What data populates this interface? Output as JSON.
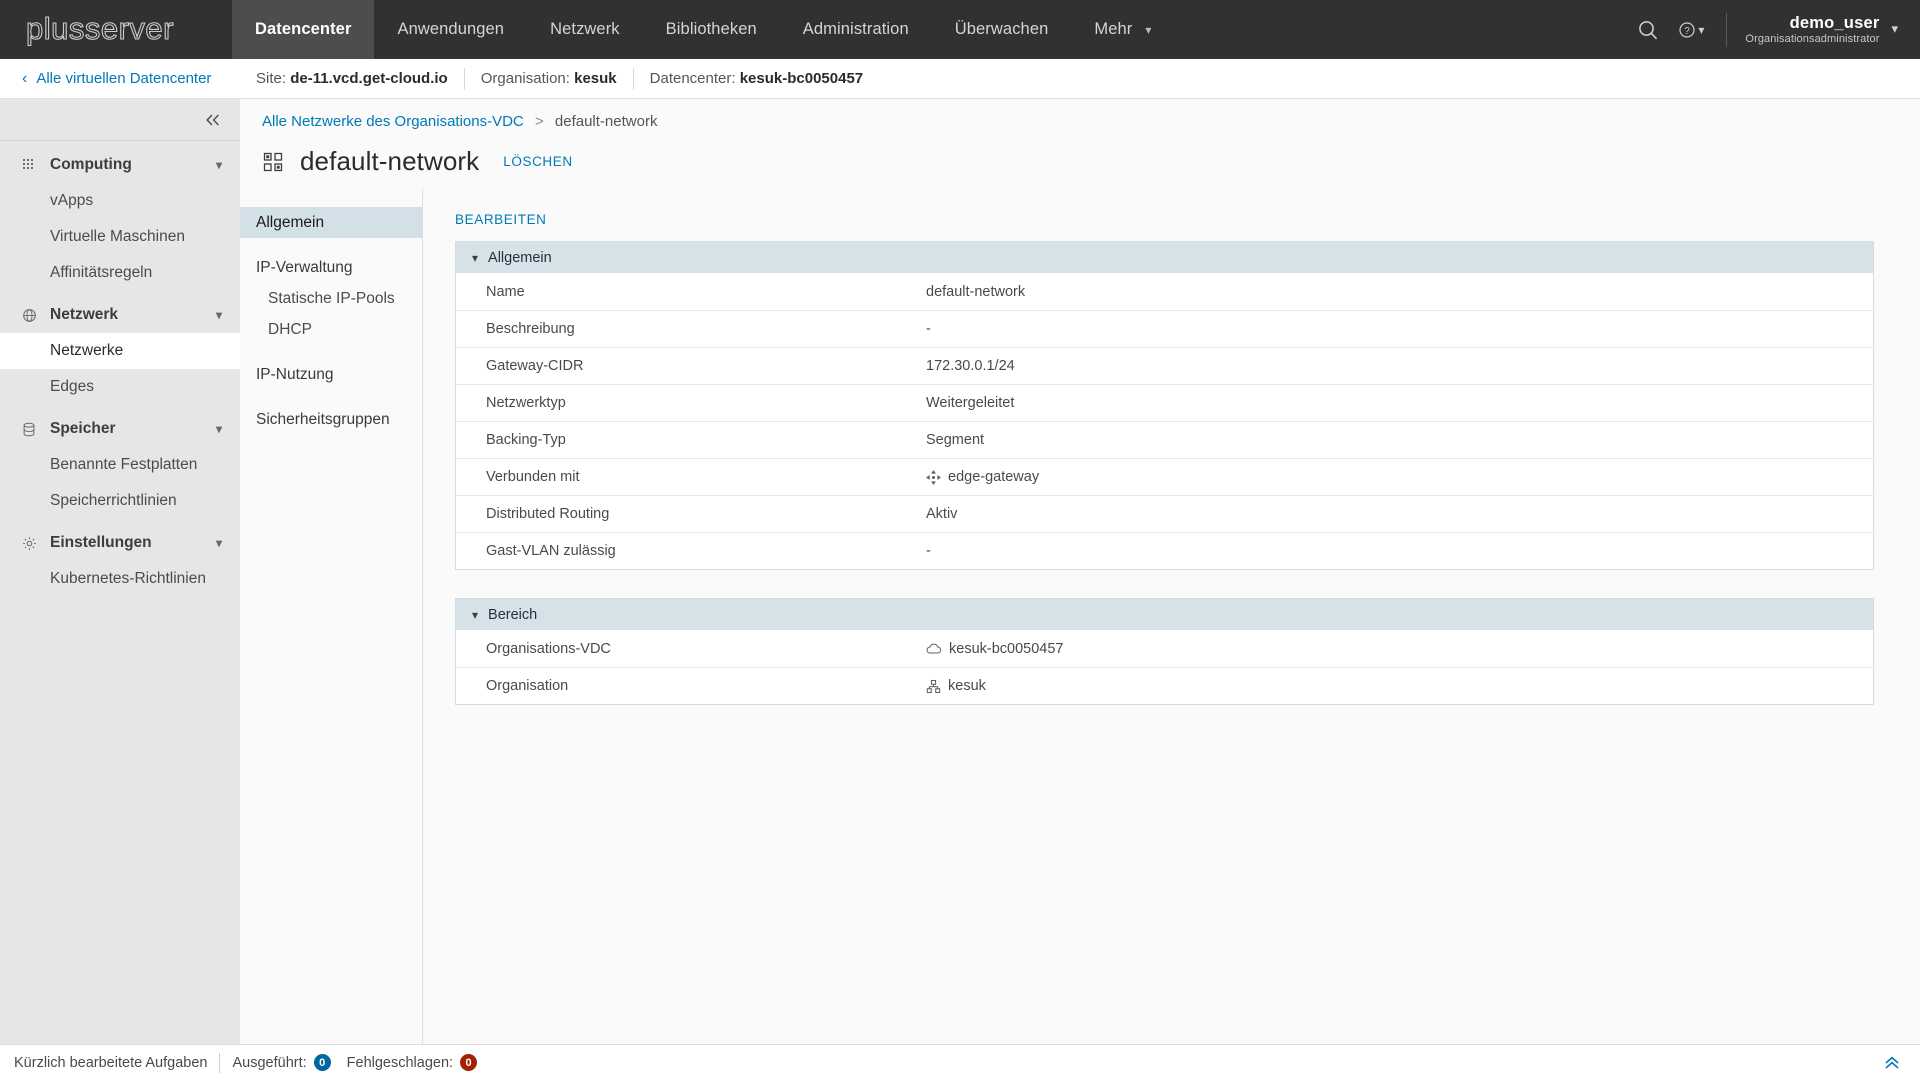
{
  "topnav": {
    "brand": "plusserver",
    "items": [
      {
        "label": "Datencenter",
        "active": true,
        "caret": false
      },
      {
        "label": "Anwendungen",
        "active": false,
        "caret": false
      },
      {
        "label": "Netzwerk",
        "active": false,
        "caret": false
      },
      {
        "label": "Bibliotheken",
        "active": false,
        "caret": false
      },
      {
        "label": "Administration",
        "active": false,
        "caret": false
      },
      {
        "label": "Überwachen",
        "active": false,
        "caret": false
      },
      {
        "label": "Mehr",
        "active": false,
        "caret": true
      }
    ],
    "search_icon": "search-icon",
    "help_icon": "help-icon",
    "user_name": "demo_user",
    "user_role": "Organisationsadministrator"
  },
  "context_bar": {
    "back_label": "Alle virtuellen Datencenter",
    "site_label": "Site:",
    "site_value": "de-11.vcd.get-cloud.io",
    "org_label": "Organisation:",
    "org_value": "kesuk",
    "dc_label": "Datencenter:",
    "dc_value": "kesuk-bc0050457"
  },
  "sidebar": {
    "collapse_label": "«",
    "groups": [
      {
        "label": "Computing",
        "icon": "grid-dots-icon",
        "items": [
          {
            "label": "vApps",
            "selected": false
          },
          {
            "label": "Virtuelle Maschinen",
            "selected": false
          },
          {
            "label": "Affinitätsregeln",
            "selected": false
          }
        ]
      },
      {
        "label": "Netzwerk",
        "icon": "globe-icon",
        "items": [
          {
            "label": "Netzwerke",
            "selected": true
          },
          {
            "label": "Edges",
            "selected": false
          }
        ]
      },
      {
        "label": "Speicher",
        "icon": "database-icon",
        "items": [
          {
            "label": "Benannte Festplatten",
            "selected": false
          },
          {
            "label": "Speicherrichtlinien",
            "selected": false
          }
        ]
      },
      {
        "label": "Einstellungen",
        "icon": "gear-icon",
        "items": [
          {
            "label": "Kubernetes-Richtlinien",
            "selected": false
          }
        ]
      }
    ]
  },
  "page": {
    "breadcrumb_link": "Alle Netzwerke des Organisations-VDC",
    "breadcrumb_sep": ">",
    "breadcrumb_current": "default-network",
    "title": "default-network",
    "title_icon": "network-icon",
    "delete_label": "LÖSCHEN"
  },
  "subnav": [
    {
      "label": "Allgemein",
      "active": true,
      "sub": false
    },
    {
      "label": "IP-Verwaltung",
      "active": false,
      "sub": false
    },
    {
      "label": "Statische IP-Pools",
      "active": false,
      "sub": true
    },
    {
      "label": "DHCP",
      "active": false,
      "sub": true
    },
    {
      "label": "IP-Nutzung",
      "active": false,
      "sub": false
    },
    {
      "label": "Sicherheitsgruppen",
      "active": false,
      "sub": false
    }
  ],
  "detail": {
    "edit_label": "BEARBEITEN",
    "sections": [
      {
        "title": "Allgemein",
        "rows": [
          {
            "key": "Name",
            "value": "default-network",
            "icon": null
          },
          {
            "key": "Beschreibung",
            "value": "-",
            "icon": null
          },
          {
            "key": "Gateway-CIDR",
            "value": "172.30.0.1/24",
            "icon": null
          },
          {
            "key": "Netzwerktyp",
            "value": "Weitergeleitet",
            "icon": null
          },
          {
            "key": "Backing-Typ",
            "value": "Segment",
            "icon": null
          },
          {
            "key": "Verbunden mit",
            "value": "edge-gateway",
            "icon": "edge-gateway-icon"
          },
          {
            "key": "Distributed Routing",
            "value": "Aktiv",
            "icon": null
          },
          {
            "key": "Gast-VLAN zulässig",
            "value": "-",
            "icon": null
          }
        ]
      },
      {
        "title": "Bereich",
        "rows": [
          {
            "key": "Organisations-VDC",
            "value": "kesuk-bc0050457",
            "icon": "cloud-icon"
          },
          {
            "key": "Organisation",
            "value": "kesuk",
            "icon": "org-icon"
          }
        ]
      }
    ]
  },
  "footer": {
    "tasks_label": "Kürzlich bearbeitete Aufgaben",
    "executed_label": "Ausgeführt:",
    "executed_count": "0",
    "failed_label": "Fehlgeschlagen:",
    "failed_count": "0",
    "expand_icon": "chevron-double-up-icon"
  },
  "colors": {
    "topnav_bg": "#313131",
    "topnav_active": "#4d4d4d",
    "link": "#0079b8",
    "card_header": "#d6e1e8",
    "subnav_active": "#d3e0e8",
    "sidebar_bg": "#e6e6e6",
    "badge_ok": "#0065a0",
    "badge_fail": "#a32100"
  }
}
